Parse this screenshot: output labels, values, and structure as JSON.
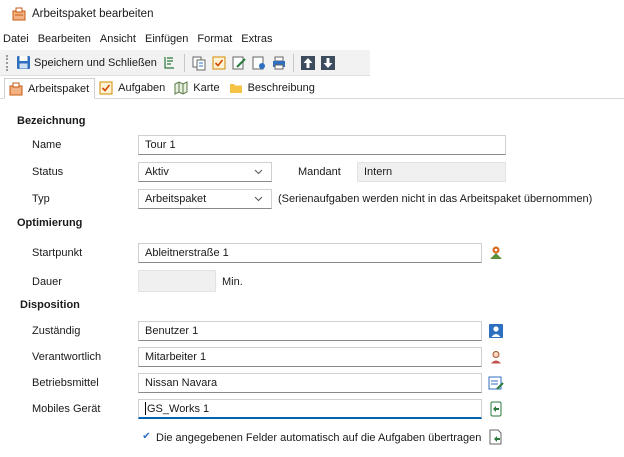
{
  "window": {
    "title": "Arbeitspaket bearbeiten"
  },
  "menu": [
    "Datei",
    "Bearbeiten",
    "Ansicht",
    "Einfügen",
    "Format",
    "Extras"
  ],
  "toolbar": {
    "save_close_label": "Speichern und Schließen"
  },
  "tabs": [
    {
      "label": "Arbeitspaket",
      "icon": "package-icon",
      "active": true
    },
    {
      "label": "Aufgaben",
      "icon": "task-check-icon",
      "active": false
    },
    {
      "label": "Karte",
      "icon": "map-icon",
      "active": false
    },
    {
      "label": "Beschreibung",
      "icon": "folder-icon",
      "active": false
    }
  ],
  "sections": {
    "bezeichnung": "Bezeichnung",
    "optimierung": "Optimierung",
    "disposition": "Disposition"
  },
  "form": {
    "name": {
      "label": "Name",
      "value": "Tour 1"
    },
    "status": {
      "label": "Status",
      "value": "Aktiv"
    },
    "mandant": {
      "label": "Mandant",
      "value": "Intern"
    },
    "typ": {
      "label": "Typ",
      "value": "Arbeitspaket",
      "note": "(Serienaufgaben werden nicht in das Arbeitspaket übernommen)"
    },
    "startpunkt": {
      "label": "Startpunkt",
      "value": "Ableitnerstraße 1"
    },
    "dauer": {
      "label": "Dauer",
      "value": "",
      "unit": "Min."
    },
    "zustaendig": {
      "label": "Zuständig",
      "value": "Benutzer 1"
    },
    "verantwortlich": {
      "label": "Verantwortlich",
      "value": "Mitarbeiter 1"
    },
    "betriebsmittel": {
      "label": "Betriebsmittel",
      "value": "Nissan Navara"
    },
    "mobiles_geraet": {
      "label": "Mobiles Gerät",
      "value": "GS_Works 1"
    },
    "auto_transfer": {
      "label": "Die angegebenen Felder automatisch auf die Aufgaben übertragen",
      "checked": true
    }
  },
  "colors": {
    "accent": "#0063b1",
    "section_bg": "#ffffff",
    "toolbar_bg": "#f2f2f2"
  }
}
